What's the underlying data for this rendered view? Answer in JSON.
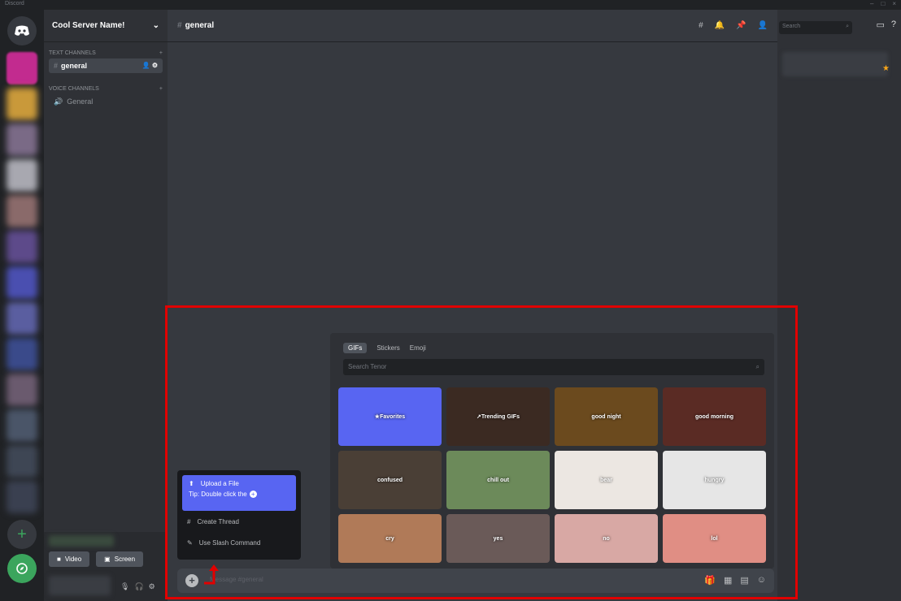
{
  "window": {
    "app_name": "Discord"
  },
  "server": {
    "name": "Cool Server Name!"
  },
  "categories": {
    "text": "TEXT CHANNELS",
    "voice": "VOICE CHANNELS"
  },
  "channels": {
    "text_active": "general",
    "voice": "General"
  },
  "header": {
    "channel_name": "general"
  },
  "search": {
    "placeholder": "Search"
  },
  "picker": {
    "tabs": [
      "GIFs",
      "Stickers",
      "Emoji"
    ],
    "search_placeholder": "Search Tenor",
    "gifs": [
      {
        "label": "Favorites",
        "bg": "#5865f2",
        "icon": "star-icon"
      },
      {
        "label": "Trending GIFs",
        "bg": "#3b2a22",
        "icon": "trending-icon"
      },
      {
        "label": "good night",
        "bg": "#6b4a1e"
      },
      {
        "label": "good morning",
        "bg": "#5a2b24"
      },
      {
        "label": "confused",
        "bg": "#4a3f36"
      },
      {
        "label": "chill out",
        "bg": "#6c8a5a"
      },
      {
        "label": "bear",
        "bg": "#ece7e2"
      },
      {
        "label": "hungry",
        "bg": "#e6e6e6"
      },
      {
        "label": "cry",
        "bg": "#b07a58"
      },
      {
        "label": "yes",
        "bg": "#6a5a58"
      },
      {
        "label": "no",
        "bg": "#d8a8a4"
      },
      {
        "label": "lol",
        "bg": "#e08e84"
      }
    ]
  },
  "attach_menu": {
    "upload": "Upload a File",
    "tip": "Tip: Double click the",
    "thread": "Create Thread",
    "slash": "Use Slash Command"
  },
  "composer": {
    "placeholder": "Message #general"
  },
  "user_area": {
    "video": "Video",
    "screen": "Screen"
  },
  "colors": {
    "accent": "#5865f2",
    "highlight_box": "#e10000",
    "status_online": "#3ba55d"
  }
}
